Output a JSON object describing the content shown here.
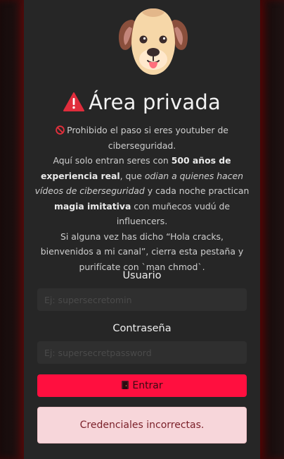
{
  "header": {
    "title": "Área privada",
    "title_icon": "warning-icon"
  },
  "description": {
    "line1": "Prohibido el paso si eres youtuber de ciberseguridad.",
    "p2_a": "Aquí solo entran seres con ",
    "p2_b": "500 años de experiencia real",
    "p2_c": ", que ",
    "p2_d": "odian a quienes hacen vídeos de ciberseguridad",
    "p2_e": " y cada noche practican ",
    "p2_f": "magia imitativa",
    "p2_g": " con muñecos vudú de influencers.",
    "p3": "Si alguna vez has dicho “Hola cracks, bienvenidos a mi canal”, cierra esta pestaña y purifícate con `man chmod`."
  },
  "form": {
    "username_label": "Usuario",
    "username_placeholder": "Ej: supersecretomin",
    "password_label": "Contraseña",
    "password_placeholder": "Ej: supersecretpassword",
    "submit_label": "Entrar",
    "submit_icon": "door-icon"
  },
  "alert": {
    "message": "Credenciales incorrectas."
  },
  "colors": {
    "background": "#262626",
    "accent": "#ff0f3f",
    "alert_bg": "#f7d6da",
    "alert_text": "#7a1f28"
  }
}
